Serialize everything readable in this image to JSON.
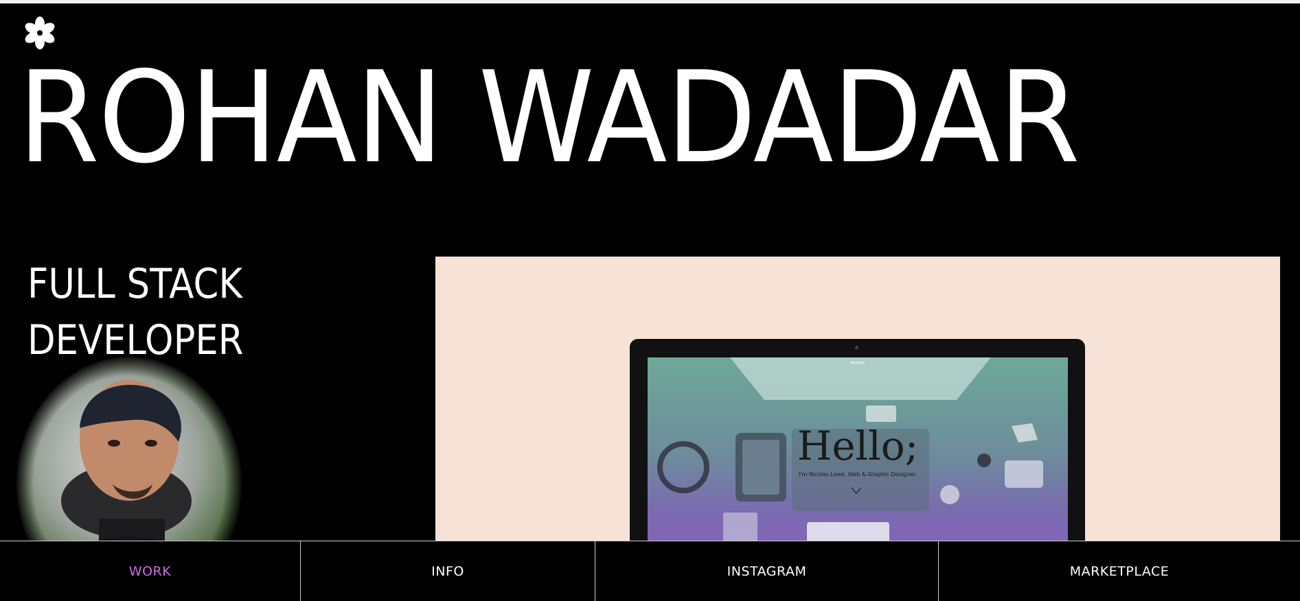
{
  "header": {
    "logo_icon": "asterisk-flower-icon",
    "name": "ROHAN WADADAR"
  },
  "hero": {
    "role_line_1": "FULL STACK",
    "role_line_2": "DEVELOPER"
  },
  "project_preview": {
    "background_color": "#f7e2d7",
    "screen": {
      "nav_text": "Home",
      "headline": "Hello;",
      "subtext": "I'm Nicolas Lowe. Web & Graphic Designer.",
      "chevron_icon": "chevron-down-icon"
    }
  },
  "nav": {
    "active_color": "#c86ee8",
    "items": [
      {
        "label": "WORK",
        "active": true
      },
      {
        "label": "INFO",
        "active": false
      },
      {
        "label": "INSTAGRAM",
        "active": false
      },
      {
        "label": "MARKETPLACE",
        "active": false
      }
    ]
  }
}
